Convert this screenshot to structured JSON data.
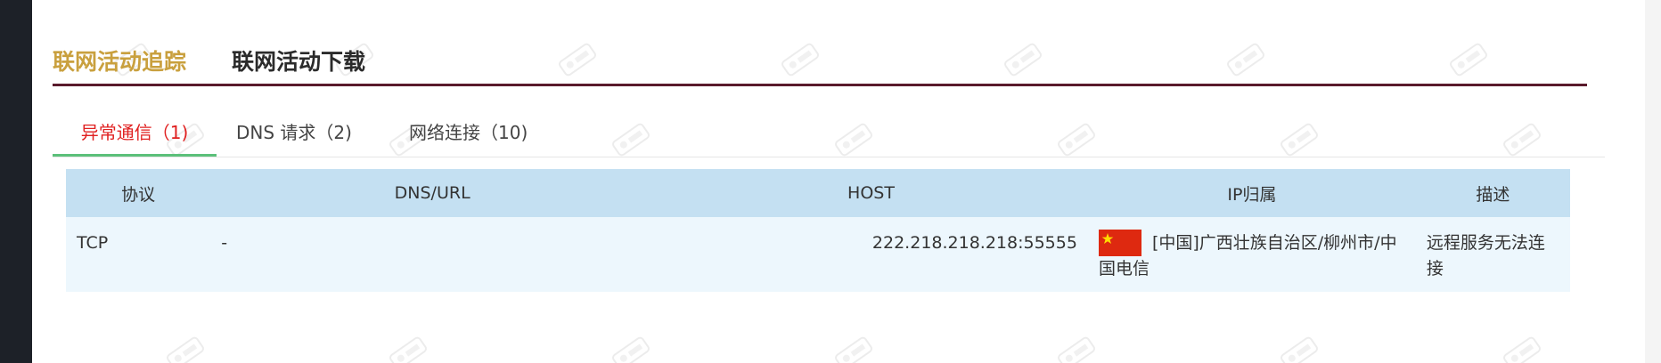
{
  "title_tabs": {
    "active": "联网活动追踪",
    "inactive": "联网活动下载"
  },
  "subtabs": [
    {
      "label": "异常通信（1)",
      "active": true
    },
    {
      "label": "DNS 请求（2)",
      "active": false
    },
    {
      "label": "网络连接（10)",
      "active": false
    }
  ],
  "table": {
    "headers": [
      "协议",
      "DNS/URL",
      "HOST",
      "IP归属",
      "描述"
    ],
    "rows": [
      {
        "protocol": "TCP",
        "dns_url": "-",
        "host": "222.218.218.218:55555",
        "ip_flag": "china-flag-icon",
        "ip_location": "[中国]广西壮族自治区/柳州市/中国电信",
        "description": "远程服务无法连接"
      }
    ]
  },
  "colors": {
    "active_title": "#c9a03e",
    "title_underline": "#5a1a2c",
    "active_subtab": "#e02020",
    "subtab_indicator": "#5cc07a",
    "table_header_bg": "#c4e0f2",
    "table_row_bg": "#edf7fd",
    "sidebar": "#1d2128"
  }
}
